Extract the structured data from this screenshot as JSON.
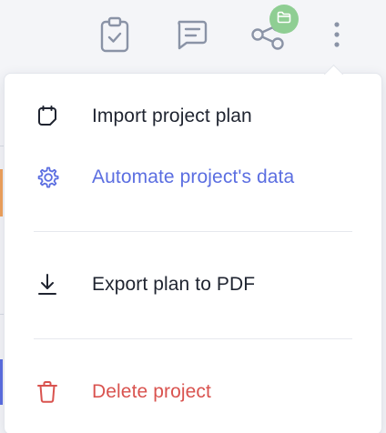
{
  "colors": {
    "icon_gray": "#8a93a6",
    "text_dark": "#1f2430",
    "accent_blue": "#5b6ee1",
    "danger_red": "#d9534f",
    "badge_green": "#8fce93"
  },
  "toolbar": {
    "icons": [
      "clipboard-check-icon",
      "comment-icon",
      "share-icon",
      "more-vertical-icon"
    ],
    "badge_icon": "folder-icon"
  },
  "menu": {
    "items": [
      {
        "label": "Import project plan",
        "icon": "import-icon",
        "color": "#1f2430"
      },
      {
        "label": "Automate project's data",
        "icon": "gear-icon",
        "color": "#5b6ee1"
      },
      {
        "label": "Export plan to PDF",
        "icon": "download-icon",
        "color": "#1f2430"
      },
      {
        "label": "Delete project",
        "icon": "trash-icon",
        "color": "#d9534f"
      }
    ]
  }
}
